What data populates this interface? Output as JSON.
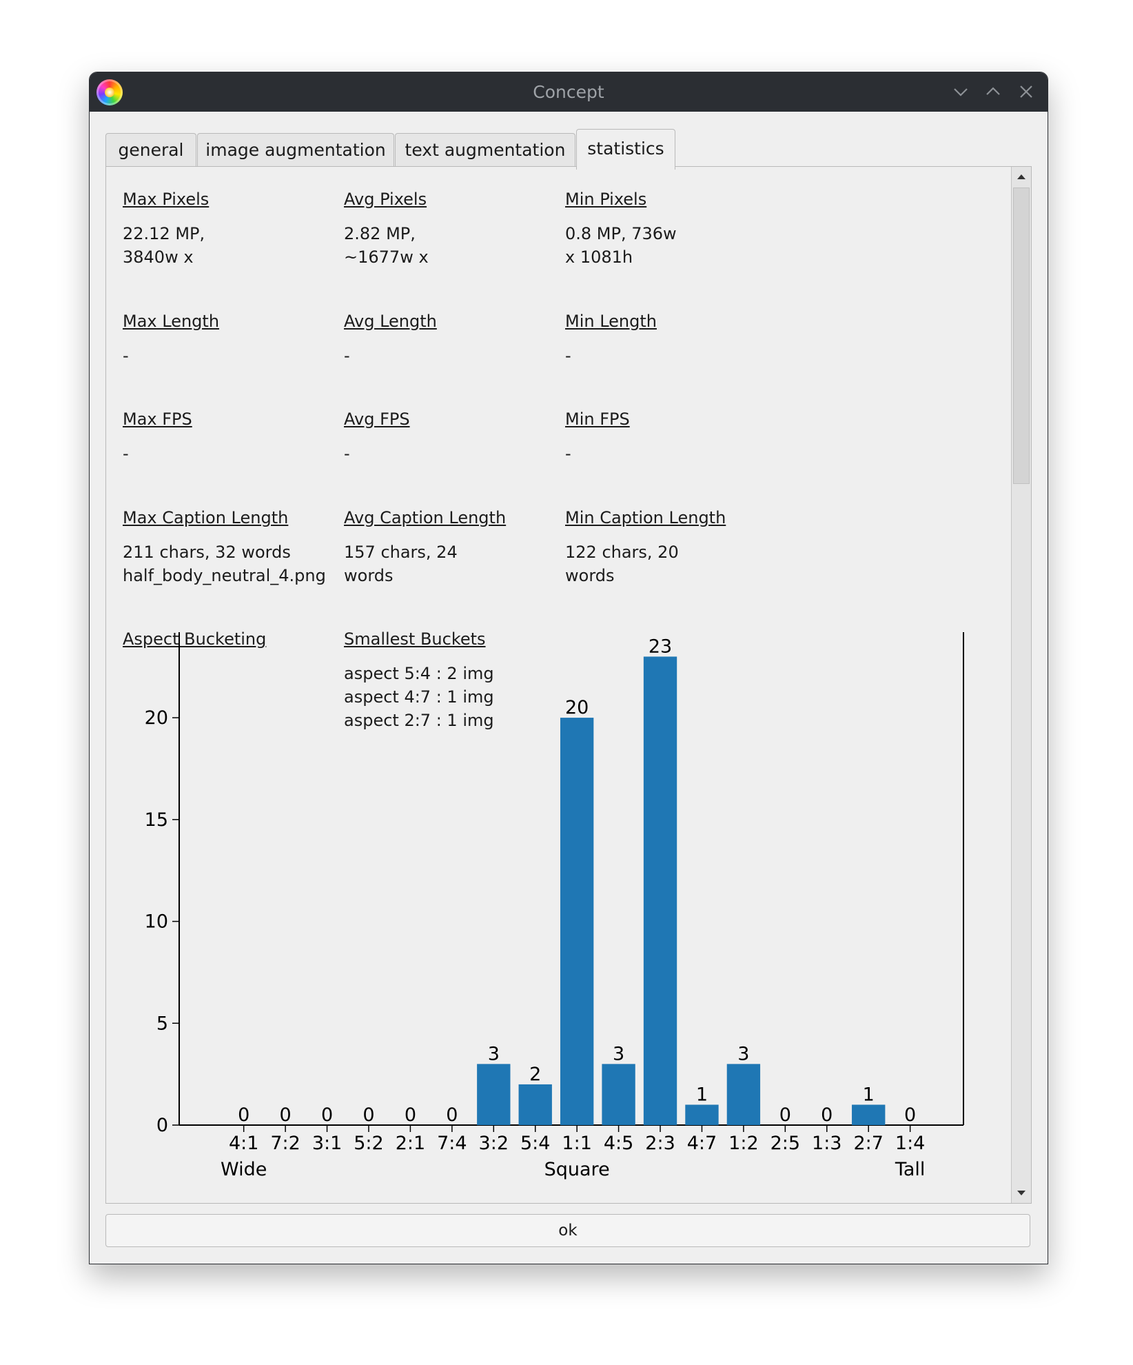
{
  "window": {
    "title": "Concept"
  },
  "tabs": [
    "general",
    "image augmentation",
    "text augmentation",
    "statistics"
  ],
  "stats": {
    "max_pixels": {
      "label": "Max Pixels",
      "value": "22.12 MP,\n3840w x"
    },
    "avg_pixels": {
      "label": "Avg Pixels",
      "value": "2.82 MP,\n~1677w x"
    },
    "min_pixels": {
      "label": "Min Pixels",
      "value": "0.8 MP, 736w\nx 1081h"
    },
    "max_length": {
      "label": "Max Length",
      "value": "-"
    },
    "avg_length": {
      "label": "Avg Length",
      "value": "-"
    },
    "min_length": {
      "label": "Min Length",
      "value": "-"
    },
    "max_fps": {
      "label": "Max FPS",
      "value": "-"
    },
    "avg_fps": {
      "label": "Avg FPS",
      "value": "-"
    },
    "min_fps": {
      "label": "Min FPS",
      "value": "-"
    },
    "max_caption": {
      "label": "Max Caption Length",
      "value": "211 chars, 32 words\nhalf_body_neutral_4.png"
    },
    "avg_caption": {
      "label": "Avg Caption Length",
      "value": "157 chars, 24\nwords"
    },
    "min_caption": {
      "label": "Min Caption Length",
      "value": "122 chars, 20\nwords"
    },
    "aspect_bucketing": {
      "label": "Aspect Bucketing"
    },
    "smallest_buckets": {
      "label": "Smallest Buckets",
      "value": "aspect 5:4 : 2 img\naspect 4:7 : 1 img\naspect 2:7 : 1 img"
    }
  },
  "chart_data": {
    "type": "bar",
    "categories": [
      "4:1",
      "7:2",
      "3:1",
      "5:2",
      "2:1",
      "7:4",
      "3:2",
      "5:4",
      "1:1",
      "4:5",
      "2:3",
      "4:7",
      "1:2",
      "2:5",
      "1:3",
      "2:7",
      "1:4"
    ],
    "values": [
      0,
      0,
      0,
      0,
      0,
      0,
      3,
      2,
      20,
      3,
      23,
      1,
      3,
      0,
      0,
      1,
      0
    ],
    "yticks": [
      0,
      5,
      10,
      15,
      20
    ],
    "ylim": [
      0,
      24.2
    ],
    "group_labels": [
      "Wide",
      "Square",
      "Tall"
    ],
    "bar_color": "#1f77b4",
    "data_labels": true
  },
  "buttons": {
    "ok": "ok"
  }
}
